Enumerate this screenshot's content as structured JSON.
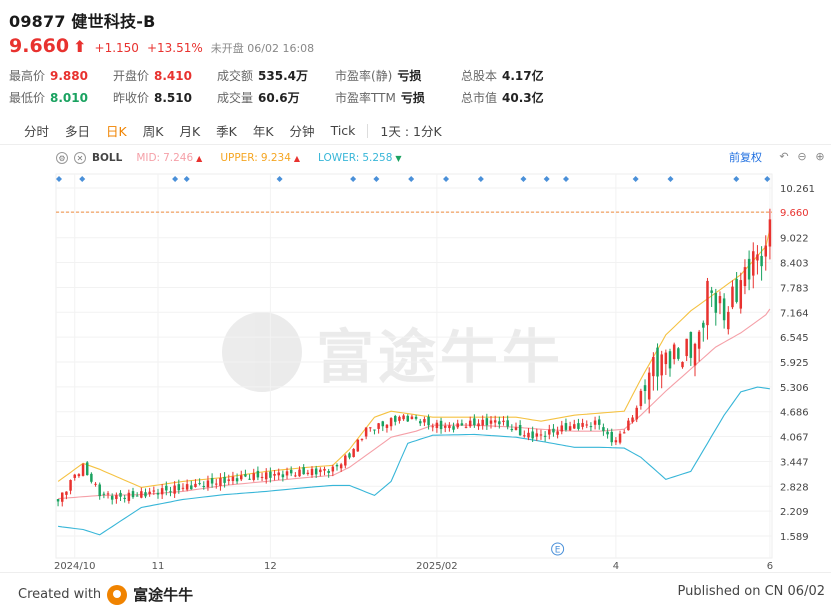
{
  "header": {
    "title": "09877 健世科技-B",
    "price": "9.660",
    "change": "+1.150",
    "change_pct": "+13.51%",
    "status": "未开盘 06/02 16:08"
  },
  "stats": [
    {
      "label": "最高价",
      "value": "9.880",
      "color": "red"
    },
    {
      "label": "开盘价",
      "value": "8.410",
      "color": "red"
    },
    {
      "label": "成交额",
      "value": "535.4万",
      "color": "normal"
    },
    {
      "label": "市盈率(静)",
      "value": "亏损",
      "color": "normal"
    },
    {
      "label": "总股本",
      "value": "4.17亿",
      "color": "normal"
    },
    {
      "label": "最低价",
      "value": "8.010",
      "color": "green"
    },
    {
      "label": "昨收价",
      "value": "8.510",
      "color": "normal"
    },
    {
      "label": "成交量",
      "value": "60.6万",
      "color": "normal"
    },
    {
      "label": "市盈率TTM",
      "value": "亏损",
      "color": "normal"
    },
    {
      "label": "总市值",
      "value": "40.3亿",
      "color": "normal"
    }
  ],
  "tabs": [
    "分时",
    "多日",
    "日K",
    "周K",
    "月K",
    "季K",
    "年K",
    "分钟",
    "Tick",
    "1天 : 1分K"
  ],
  "active_tab": "日K",
  "toolbar": {
    "indicator": "BOLL",
    "mid_label": "MID:",
    "mid_value": "7.246",
    "upper_label": "UPPER:",
    "upper_value": "9.234",
    "lower_label": "LOWER:",
    "lower_value": "5.258",
    "adjust": "前复权"
  },
  "footer": {
    "created": "Created with",
    "brand": "富途牛牛",
    "published": "Published on CN 06/02",
    "watermark": "富途牛牛"
  },
  "colors": {
    "up": "#e8322f",
    "down": "#1aa260",
    "mid": "#f5a0a8",
    "upper": "#f5c242",
    "lower": "#38b6d8",
    "accent": "#f08300",
    "link": "#1f6fe0"
  },
  "chart_data": {
    "type": "candlestick",
    "y_ticks": [
      "10.261",
      "9.660",
      "9.022",
      "8.403",
      "7.783",
      "7.164",
      "6.545",
      "5.925",
      "5.306",
      "4.686",
      "4.067",
      "3.447",
      "2.828",
      "2.209",
      "1.589"
    ],
    "ylim": [
      1.589,
      10.261
    ],
    "last_price": 9.66,
    "x_tick_labels": [
      "2024/10",
      "11",
      "12",
      "2025/02",
      "4",
      "6"
    ],
    "x_tick_days": [
      4,
      24,
      51,
      91,
      134,
      171
    ],
    "n_days": 172,
    "event_marker": {
      "label": "E",
      "day": 120
    },
    "series_names": [
      "MID",
      "UPPER",
      "LOWER"
    ],
    "anchors": {
      "close": [
        [
          0,
          2.45
        ],
        [
          4,
          3.1
        ],
        [
          6,
          3.3
        ],
        [
          10,
          2.65
        ],
        [
          14,
          2.55
        ],
        [
          18,
          2.6
        ],
        [
          24,
          2.7
        ],
        [
          30,
          2.8
        ],
        [
          36,
          2.9
        ],
        [
          44,
          3.05
        ],
        [
          50,
          3.1
        ],
        [
          56,
          3.15
        ],
        [
          62,
          3.2
        ],
        [
          66,
          3.25
        ],
        [
          70,
          3.6
        ],
        [
          74,
          4.25
        ],
        [
          78,
          4.35
        ],
        [
          82,
          4.55
        ],
        [
          86,
          4.5
        ],
        [
          90,
          4.35
        ],
        [
          94,
          4.3
        ],
        [
          100,
          4.4
        ],
        [
          106,
          4.45
        ],
        [
          112,
          4.1
        ],
        [
          116,
          4.1
        ],
        [
          122,
          4.3
        ],
        [
          126,
          4.35
        ],
        [
          130,
          4.4
        ],
        [
          132,
          4.05
        ],
        [
          134,
          3.95
        ],
        [
          138,
          4.55
        ],
        [
          142,
          5.7
        ],
        [
          146,
          6.05
        ],
        [
          150,
          6.1
        ],
        [
          154,
          6.45
        ],
        [
          156,
          7.75
        ],
        [
          160,
          7.1
        ],
        [
          162,
          7.5
        ],
        [
          166,
          8.3
        ],
        [
          168,
          8.6
        ],
        [
          170,
          8.51
        ],
        [
          171,
          9.66
        ]
      ],
      "mid": [
        [
          0,
          2.52
        ],
        [
          10,
          2.6
        ],
        [
          20,
          2.62
        ],
        [
          30,
          2.7
        ],
        [
          40,
          2.85
        ],
        [
          50,
          2.95
        ],
        [
          60,
          3.05
        ],
        [
          66,
          3.1
        ],
        [
          70,
          3.3
        ],
        [
          74,
          3.6
        ],
        [
          80,
          4.05
        ],
        [
          86,
          4.2
        ],
        [
          90,
          4.35
        ],
        [
          100,
          4.35
        ],
        [
          110,
          4.3
        ],
        [
          116,
          4.25
        ],
        [
          124,
          4.2
        ],
        [
          130,
          4.2
        ],
        [
          136,
          4.25
        ],
        [
          140,
          4.6
        ],
        [
          146,
          5.2
        ],
        [
          152,
          5.75
        ],
        [
          158,
          6.3
        ],
        [
          164,
          6.65
        ],
        [
          170,
          7.1
        ],
        [
          171,
          7.246
        ]
      ],
      "upper": [
        [
          0,
          2.95
        ],
        [
          6,
          3.4
        ],
        [
          10,
          3.25
        ],
        [
          20,
          2.8
        ],
        [
          30,
          2.95
        ],
        [
          40,
          3.05
        ],
        [
          50,
          3.2
        ],
        [
          60,
          3.3
        ],
        [
          66,
          3.35
        ],
        [
          70,
          3.75
        ],
        [
          76,
          4.55
        ],
        [
          80,
          4.7
        ],
        [
          90,
          4.55
        ],
        [
          100,
          4.55
        ],
        [
          110,
          4.55
        ],
        [
          116,
          4.45
        ],
        [
          124,
          4.6
        ],
        [
          130,
          4.65
        ],
        [
          136,
          4.7
        ],
        [
          140,
          5.5
        ],
        [
          146,
          6.6
        ],
        [
          152,
          7.2
        ],
        [
          158,
          7.65
        ],
        [
          164,
          8.1
        ],
        [
          170,
          8.8
        ],
        [
          171,
          9.234
        ]
      ],
      "lower": [
        [
          0,
          1.83
        ],
        [
          6,
          1.75
        ],
        [
          10,
          1.62
        ],
        [
          20,
          2.3
        ],
        [
          30,
          2.5
        ],
        [
          40,
          2.62
        ],
        [
          50,
          2.7
        ],
        [
          60,
          2.8
        ],
        [
          66,
          2.85
        ],
        [
          70,
          2.85
        ],
        [
          76,
          2.6
        ],
        [
          80,
          2.95
        ],
        [
          84,
          3.9
        ],
        [
          90,
          4.1
        ],
        [
          100,
          4.12
        ],
        [
          110,
          4.05
        ],
        [
          116,
          3.95
        ],
        [
          124,
          3.8
        ],
        [
          130,
          3.8
        ],
        [
          136,
          3.78
        ],
        [
          140,
          3.55
        ],
        [
          146,
          3.0
        ],
        [
          152,
          3.2
        ],
        [
          156,
          3.9
        ],
        [
          160,
          4.6
        ],
        [
          164,
          5.18
        ],
        [
          168,
          5.3
        ],
        [
          171,
          5.258
        ]
      ]
    }
  }
}
